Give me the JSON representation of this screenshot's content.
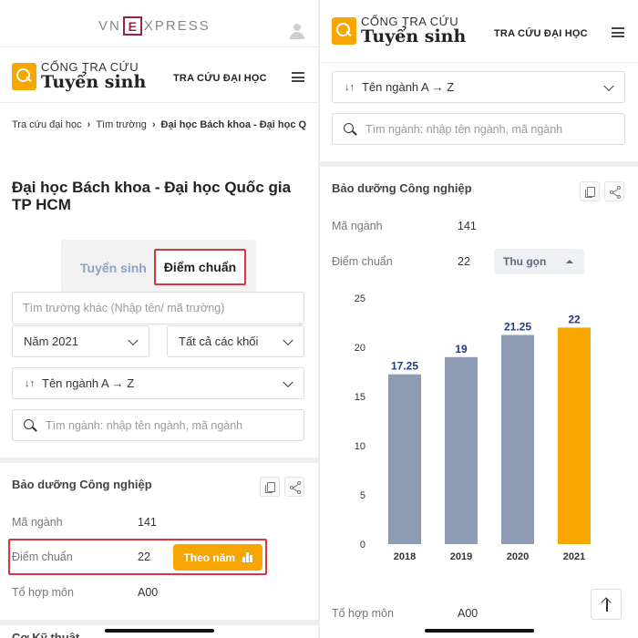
{
  "brand": {
    "vne_left": "VN",
    "vne_mark": "E",
    "vne_right": "XPRESS",
    "logo_top": "CỔNG TRA CỨU",
    "logo_bottom": "Tuyển sinh",
    "nav_title": "TRA CỨU ĐẠI HỌC"
  },
  "breadcrumb": {
    "items": [
      "Tra cứu đại học",
      "Tìm trường",
      "Đại học Bách khoa - Đại học Q"
    ]
  },
  "page_title": "Đại học Bách khoa - Đại học Quốc gia TP HCM",
  "tabs": [
    {
      "label": "Tuyển sinh",
      "active": false
    },
    {
      "label": "Điểm chuẩn",
      "active": true
    }
  ],
  "filters": {
    "school_placeholder": "Tìm trường khác (Nhập tên/ mã trường)",
    "year": "Năm 2021",
    "block": "Tất cả các khối",
    "sort_icon": "↓↑",
    "sort": "Tên ngành A → Z",
    "major_placeholder": "Tìm ngành: nhập tên ngành, mã ngành"
  },
  "major": {
    "name": "Bảo dưỡng Công nghiệp",
    "code_label": "Mã ngành",
    "code": "141",
    "score_label": "Điểm chuẩn",
    "score": "22",
    "combo_label": "Tổ hợp môn",
    "combo": "A00",
    "by_year_button": "Theo năm",
    "collapse_button": "Thu gọn"
  },
  "next_major_partial": "Cơ Kỹ thuật",
  "icons": {
    "copy": "copy-icon",
    "share": "share-icon",
    "search": "search-icon",
    "chevron": "chevron-down-icon",
    "user": "user-icon",
    "menu": "hamburger-icon",
    "bar_chart": "bar-chart-icon",
    "scroll_top": "arrow-up-icon"
  },
  "colors": {
    "accent": "#f7a600",
    "bar_default": "#8e9bb5",
    "bar_highlight": "#f7a600",
    "value_label": "#1f3c88",
    "highlight_border": "#d9363e"
  },
  "chart_data": {
    "type": "bar",
    "categories": [
      "2018",
      "2019",
      "2020",
      "2021"
    ],
    "values": [
      17.25,
      19,
      21.25,
      22
    ],
    "value_labels": [
      "17.25",
      "19",
      "21.25",
      "22"
    ],
    "highlight_index": 3,
    "ylim": [
      0,
      25
    ],
    "yticks": [
      0,
      5,
      10,
      15,
      20,
      25
    ],
    "grid": false,
    "legend": "none",
    "title": "",
    "xlabel": "",
    "ylabel": ""
  }
}
